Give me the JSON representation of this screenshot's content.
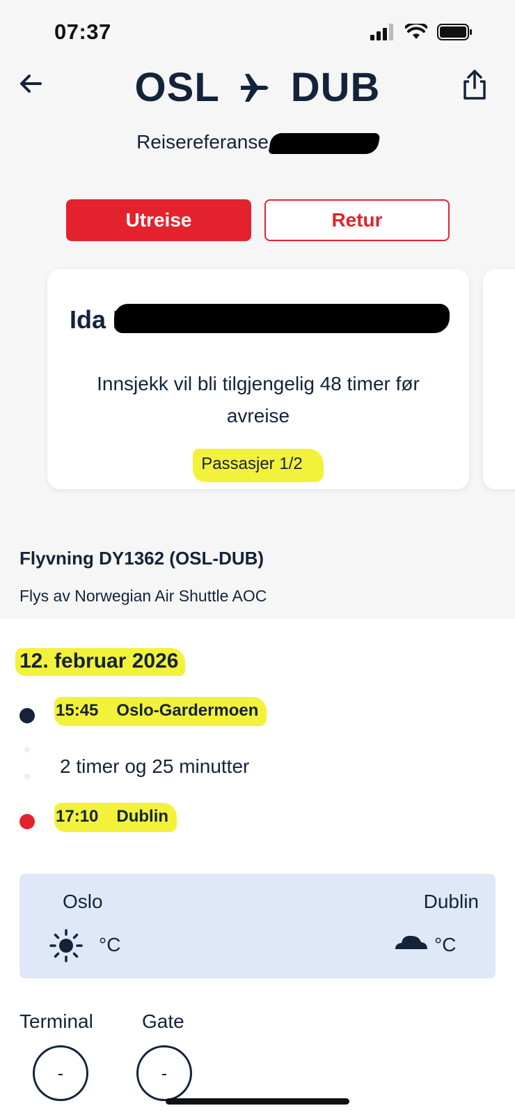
{
  "status_bar": {
    "time": "07:37"
  },
  "header": {
    "origin": "OSL",
    "destination": "DUB",
    "reference_label": "Reisereferanse"
  },
  "tabs": {
    "outbound": "Utreise",
    "return": "Retur"
  },
  "passenger_card": {
    "name_visible": "Ida M",
    "checkin_text": "Innsjekk vil bli tilgjengelig 48 timer før avreise",
    "passenger_count": "Passasjer 1/2"
  },
  "flight": {
    "title": "Flyvning DY1362 (OSL-DUB)",
    "operator": "Flys av Norwegian Air Shuttle AOC",
    "date": "12. februar 2026",
    "departure_time": "15:45",
    "departure_airport": "Oslo-Gardermoen",
    "duration": "2 timer og 25 minutter",
    "arrival_time": "17:10",
    "arrival_airport": "Dublin"
  },
  "weather": {
    "origin_city": "Oslo",
    "origin_unit": "°C",
    "origin_icon": "sun-icon",
    "destination_city": "Dublin",
    "destination_unit": "°C",
    "destination_icon": "cloud-icon"
  },
  "info": {
    "terminal_label": "Terminal",
    "terminal_value": "-",
    "gate_label": "Gate",
    "gate_value": "-"
  },
  "colors": {
    "brand_red": "#e4222e",
    "navy": "#13233a",
    "highlight": "#f3f23a",
    "weather_bg": "#dfe8f7"
  }
}
